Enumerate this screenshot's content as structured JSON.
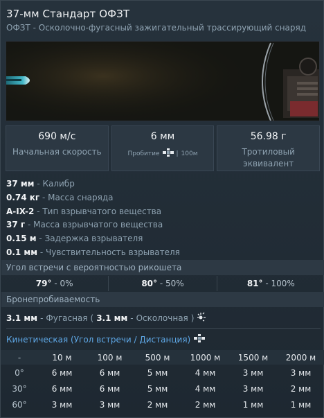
{
  "header": {
    "title": "37-мм Стандарт ОФЗТ",
    "subtitle": "ОФЗТ - Осколочно-фугасный зажигательный трассирующий снаряд"
  },
  "stats": [
    {
      "value": "690 м/с",
      "label": "Начальная скорость"
    },
    {
      "value": "6 мм",
      "sub_label": "Пробитие",
      "sub_range": "100м"
    },
    {
      "value": "56.98 г",
      "label": "Тротиловый эквивалент"
    }
  ],
  "properties": [
    {
      "value": "37 мм",
      "desc": "Калибр"
    },
    {
      "value": "0.74 кг",
      "desc": "Масса снаряда"
    },
    {
      "value": "A-IX-2",
      "desc": "Тип взрывчатого вещества"
    },
    {
      "value": "37 г",
      "desc": "Масса взрывчатого вещества"
    },
    {
      "value": "0.15 м",
      "desc": "Задержка взрывателя"
    },
    {
      "value": "0.1 мм",
      "desc": "Чувствительность взрывателя"
    }
  ],
  "ricochet": {
    "title": "Угол встречи с вероятностью рикошета",
    "cells": [
      {
        "angle": "79°",
        "percent": "0%"
      },
      {
        "angle": "80°",
        "percent": "50%"
      },
      {
        "angle": "81°",
        "percent": "100%"
      }
    ]
  },
  "penetration": {
    "title": "Бронепробиваемость",
    "he_value": "3.1 мм",
    "he_label": "Фугасная",
    "frag_value": "3.1 мм",
    "frag_label": "Осколочная"
  },
  "kinetic": {
    "title": "Кинетическая (Угол встречи / Дистанция)",
    "header": [
      "-",
      "10 м",
      "100 м",
      "500 м",
      "1000 м",
      "1500 м",
      "2000 м"
    ],
    "rows": [
      {
        "angle": "0°",
        "values": [
          "6 мм",
          "6 мм",
          "5 мм",
          "4 мм",
          "3 мм",
          "3 мм"
        ]
      },
      {
        "angle": "30°",
        "values": [
          "6 мм",
          "6 мм",
          "5 мм",
          "4 мм",
          "3 мм",
          "2 мм"
        ]
      },
      {
        "angle": "60°",
        "values": [
          "3 мм",
          "3 мм",
          "2 мм",
          "2 мм",
          "1 мм",
          "1 мм"
        ]
      }
    ]
  },
  "colors": {
    "accent_blue": "#5fa9e8",
    "muted_text": "#8fa3b2",
    "panel_bg": "#26323c"
  },
  "icons": {
    "armor_icon": "crosshair-armor-icon",
    "explosion_icon": "burst-icon"
  }
}
